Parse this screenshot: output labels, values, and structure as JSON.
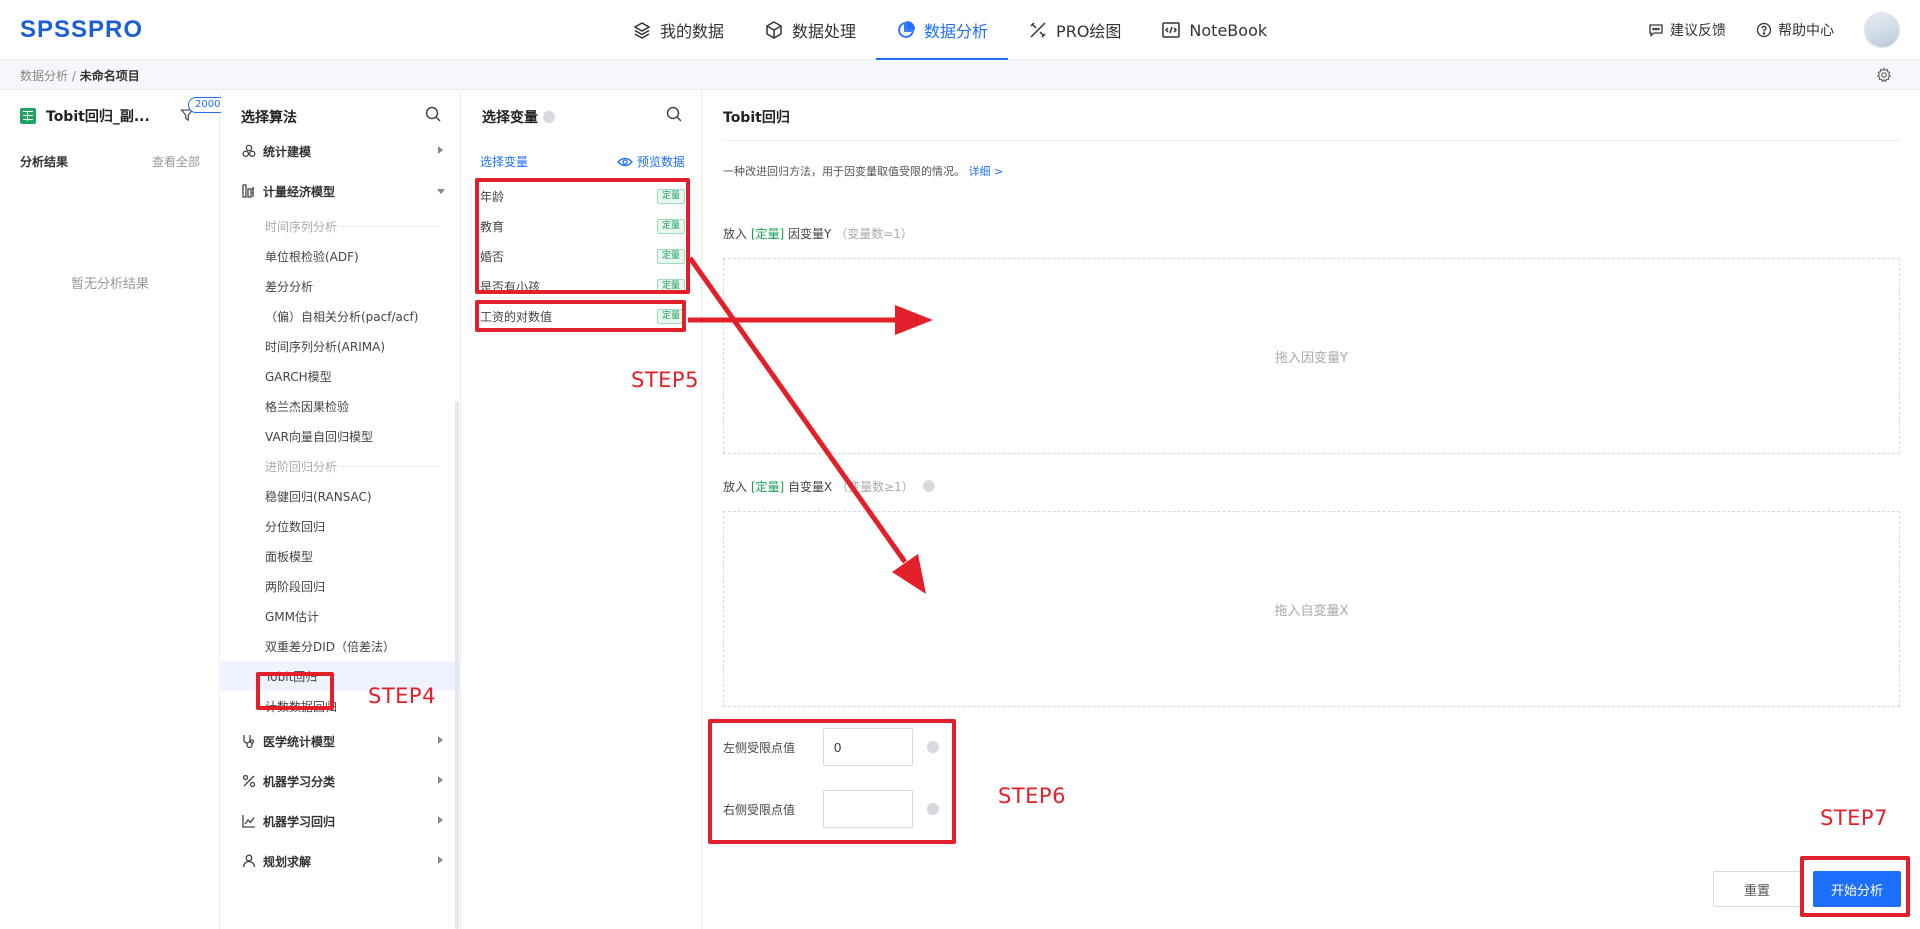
{
  "app": {
    "logo": "SPSSPRO",
    "nav": [
      {
        "label": "我的数据",
        "icon": "layers-icon"
      },
      {
        "label": "数据处理",
        "icon": "cube-icon"
      },
      {
        "label": "数据分析",
        "icon": "pie-chart-icon",
        "active": true
      },
      {
        "label": "PRO绘图",
        "icon": "pen-ruler-icon"
      },
      {
        "label": "NoteBook",
        "icon": "code-icon"
      }
    ],
    "feedback": "建议反馈",
    "help": "帮助中心",
    "accent": "#1f6fff"
  },
  "breadcrumb": {
    "parent": "数据分析 /",
    "current": "未命名项目"
  },
  "project_panel": {
    "file_name": "Tobit回归_副...",
    "count_badge": "2000",
    "results_title": "分析结果",
    "view_all": "查看全部",
    "empty": "暂无分析结果"
  },
  "algo_panel": {
    "title": "选择算法",
    "categories": {
      "stat_modeling": "统计建模",
      "econometric": "计量经济模型",
      "medical": "医学统计模型",
      "ml_class": "机器学习分类",
      "ml_reg": "机器学习回归",
      "planning": "规划求解"
    },
    "ts_head": "时间序列分析",
    "ts_items": [
      "单位根检验(ADF)",
      "差分分析",
      "（偏）自相关分析(pacf/acf)",
      "时间序列分析(ARIMA)",
      "GARCH模型",
      "格兰杰因果检验",
      "VAR向量自回归模型"
    ],
    "adv_head": "进阶回归分析",
    "adv_items": [
      "稳健回归(RANSAC)",
      "分位数回归",
      "面板模型",
      "两阶段回归",
      "GMM估计",
      "双重差分DID（倍差法）",
      "Tobit回归",
      "计数数据回归"
    ]
  },
  "var_panel": {
    "title": "选择变量",
    "tab": "选择变量",
    "preview": "预览数据",
    "tag": "定量",
    "variables": [
      "年龄",
      "教育",
      "婚否",
      "是否有小孩",
      "工资的对数值"
    ]
  },
  "config_panel": {
    "title": "Tobit回归",
    "desc": "一种改进回归方法，用于因变量取值受限的情况。",
    "detail": "详细 >",
    "y_prefix": "放入",
    "y_tag": "[定量]",
    "y_name": "因变量Y",
    "y_count": "（变量数=1）",
    "y_drop": "拖入因变量Y",
    "x_prefix": "放入",
    "x_tag": "[定量]",
    "x_name": "自变量X",
    "x_count": "（变量数≥1）",
    "x_drop": "拖入自变量X",
    "left_label": "左侧受限点值",
    "left_value": "0",
    "right_label": "右侧受限点值",
    "right_value": "",
    "reset": "重置",
    "start": "开始分析"
  },
  "annotations": {
    "step4": "STEP4",
    "step5": "STEP5",
    "step6": "STEP6",
    "step7": "STEP7",
    "color": "#e3202a"
  }
}
